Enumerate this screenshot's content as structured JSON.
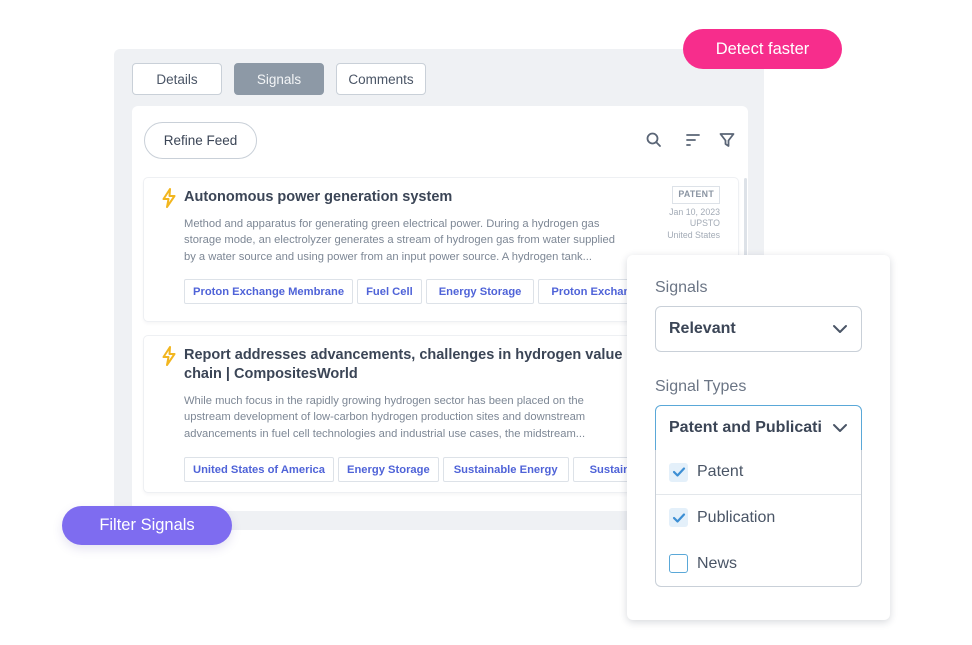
{
  "tabs": [
    {
      "label": "Details",
      "active": false
    },
    {
      "label": "Signals",
      "active": true
    },
    {
      "label": "Comments",
      "active": false
    }
  ],
  "toolbar": {
    "refine_label": "Refine Feed",
    "icons": [
      "search-icon",
      "sort-icon",
      "filter-icon"
    ]
  },
  "cards": [
    {
      "icon": "bolt-icon",
      "title": "Autonomous power generation system",
      "description": "Method and apparatus for generating green electrical power. During a hydrogen gas storage mode, an electrolyzer generates a stream of hydrogen gas from water supplied by a water source and using power from an input power source. A hydrogen tank...",
      "badge": "PATENT",
      "date": "Jan 10, 2023",
      "office": "UPSTO",
      "country": "United States",
      "tags": [
        "Proton Exchange Membrane",
        "Fuel Cell",
        "Energy Storage",
        "Proton Exchange Membrane"
      ]
    },
    {
      "icon": "bolt-icon",
      "title": "Report addresses advancements, challenges in hydrogen value chain | CompositesWorld",
      "description": "While much focus in the rapidly growing hydrogen sector has been placed on the upstream development of low-carbon hydrogen production sites and downstream advancements in fuel cell technologies and industrial use cases, the midstream...",
      "tags": [
        "United States of America",
        "Energy Storage",
        "Sustainable Energy",
        "Sustainable Energy"
      ]
    }
  ],
  "filter_panel": {
    "signals_label": "Signals",
    "signals_value": "Relevant",
    "types_label": "Signal Types",
    "types_value": "Patent and Publicati",
    "options": [
      {
        "label": "Patent",
        "checked": true
      },
      {
        "label": "Publication",
        "checked": true
      },
      {
        "label": "News",
        "checked": false
      }
    ]
  },
  "callouts": {
    "detect": "Detect faster",
    "filter": "Filter Signals"
  },
  "colors": {
    "detect_pill": "#f72d8c",
    "filter_pill": "#7e6cf0",
    "tag_text": "#4f63d8",
    "active_tab": "#8d99a6",
    "bolt": "#f2b61f",
    "checkbox": "#3d8fd4"
  }
}
